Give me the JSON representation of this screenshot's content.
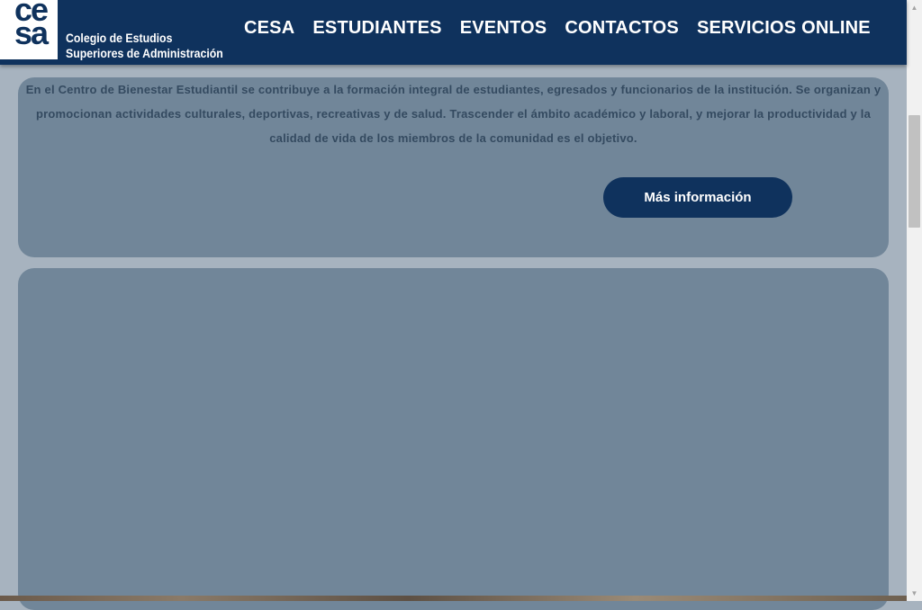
{
  "header": {
    "logo": {
      "line1": "ce",
      "line2": "sa"
    },
    "logo_text_line1": "Colegio de Estudios",
    "logo_text_line2": "Superiores de Administración",
    "nav": [
      "CESA",
      "ESTUDIANTES",
      "EVENTOS",
      "CONTACTOS",
      "SERVICIOS ONLINE"
    ]
  },
  "info_card": {
    "text": "En el Centro de Bienestar Estudiantil se contribuye a la formación integral de estudiantes, egresados y funcionarios de la institución. Se organizan y promocionan actividades culturales, deportivas, recreativas y de salud. Trascender el ámbito académico y laboral, y mejorar la productividad y la calidad de vida de los miembros de la comunidad es el objetivo.",
    "button_label": "Más información"
  },
  "colors": {
    "brand": "#0f325d",
    "page_background": "#a7b3bf",
    "card": "#718699",
    "card_text": "#344a60"
  },
  "scrollbar": {
    "up_icon": "chevron-up-icon",
    "down_icon": "chevron-down-icon"
  }
}
